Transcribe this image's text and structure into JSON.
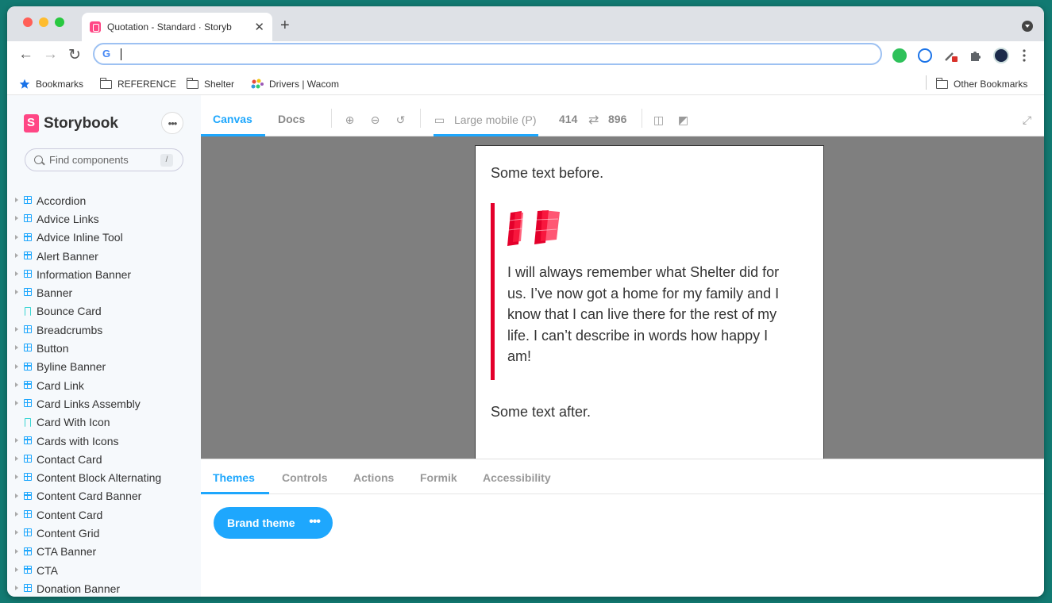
{
  "browser": {
    "tab_title": "Quotation - Standard · Storyb",
    "tab_close": "✕",
    "new_tab": "+",
    "nav": {
      "back": "←",
      "forward": "→",
      "reload": "↻"
    },
    "omnibox_value": "",
    "google_icon": "G"
  },
  "bookmarks": {
    "items": [
      {
        "label": "Bookmarks",
        "icon": "star-icon"
      },
      {
        "label": "REFERENCE",
        "icon": "folder-icon"
      },
      {
        "label": "Shelter",
        "icon": "folder-icon"
      },
      {
        "label": "Drivers | Wacom",
        "icon": "wacom-icon"
      }
    ],
    "other": "Other Bookmarks"
  },
  "sidebar": {
    "logo_text": "Storybook",
    "menu_label": "•••",
    "search_placeholder": "Find components",
    "search_shortcut": "/",
    "items": [
      {
        "label": "Accordion",
        "type": "component"
      },
      {
        "label": "Advice Links",
        "type": "component"
      },
      {
        "label": "Advice Inline Tool",
        "type": "component"
      },
      {
        "label": "Alert Banner",
        "type": "component"
      },
      {
        "label": "Information Banner",
        "type": "component"
      },
      {
        "label": "Banner",
        "type": "component"
      },
      {
        "label": "Bounce Card",
        "type": "story"
      },
      {
        "label": "Breadcrumbs",
        "type": "component"
      },
      {
        "label": "Button",
        "type": "component"
      },
      {
        "label": "Byline Banner",
        "type": "component"
      },
      {
        "label": "Card Link",
        "type": "component"
      },
      {
        "label": "Card Links Assembly",
        "type": "component"
      },
      {
        "label": "Card With Icon",
        "type": "story"
      },
      {
        "label": "Cards with Icons",
        "type": "component"
      },
      {
        "label": "Contact Card",
        "type": "component"
      },
      {
        "label": "Content Block Alternating",
        "type": "component"
      },
      {
        "label": "Content Card Banner",
        "type": "component"
      },
      {
        "label": "Content Card",
        "type": "component"
      },
      {
        "label": "Content Grid",
        "type": "component"
      },
      {
        "label": "CTA Banner",
        "type": "component"
      },
      {
        "label": "CTA",
        "type": "component"
      },
      {
        "label": "Donation Banner",
        "type": "component"
      }
    ]
  },
  "toolbar": {
    "tab_canvas": "Canvas",
    "tab_docs": "Docs",
    "viewport_label": "Large mobile (P)",
    "viewport_width": "414",
    "viewport_swap": "⇄",
    "viewport_height": "896"
  },
  "preview": {
    "text_before": "Some text before.",
    "quote": "I will always remember what Shelter did for us. I’ve now got a home for my family and I know that I can live there for the rest of my life. I can’t describe in words how happy I am!",
    "text_after": "Some text after.",
    "accent_color": "#e4002b"
  },
  "addons": {
    "tabs": [
      "Themes",
      "Controls",
      "Actions",
      "Formik",
      "Accessibility"
    ],
    "active_tab": "Themes",
    "theme_button": "Brand theme",
    "theme_menu": "•••"
  },
  "colors": {
    "storybook_blue": "#1ea7fd",
    "storybook_pink": "#ff4785"
  }
}
